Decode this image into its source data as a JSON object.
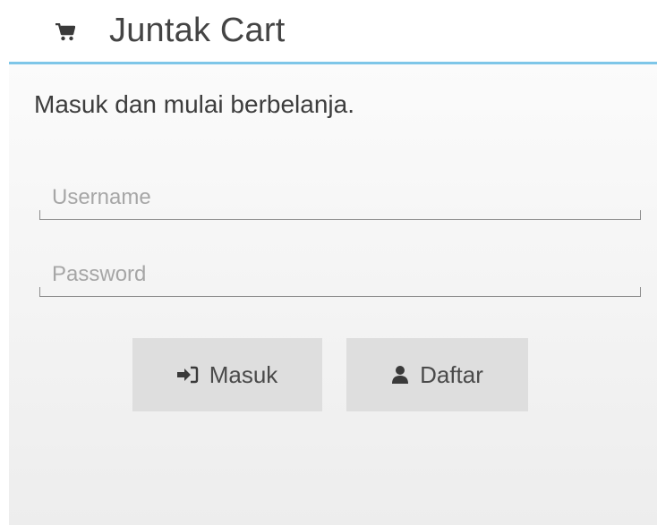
{
  "header": {
    "brand": "Juntak Cart",
    "icon": "shopping-cart-icon"
  },
  "login": {
    "subtitle": "Masuk dan mulai berbelanja.",
    "username_placeholder": "Username",
    "password_placeholder": "Password",
    "login_button_label": "Masuk",
    "login_button_icon": "sign-in-icon",
    "register_button_label": "Daftar",
    "register_button_icon": "user-icon"
  },
  "colors": {
    "accent_line": "#7ec6e8",
    "button_bg": "#dedede",
    "text": "#444444"
  }
}
